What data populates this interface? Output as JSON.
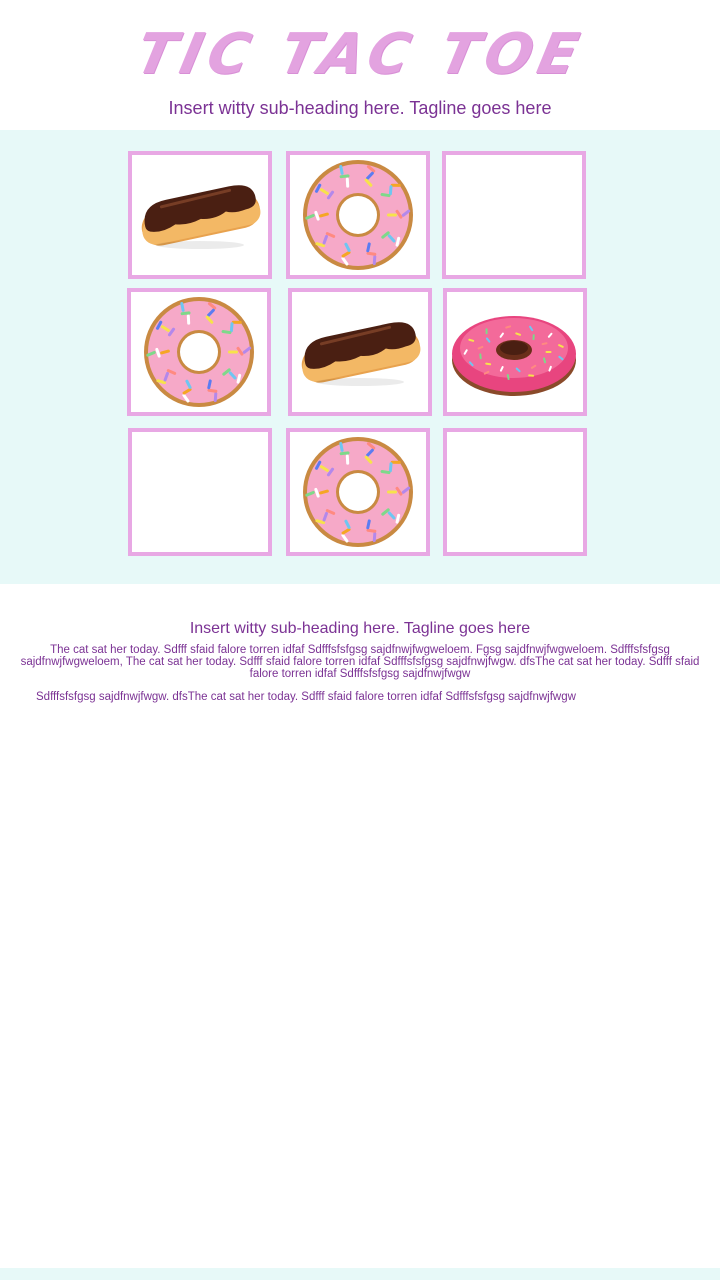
{
  "header": {
    "title": "TIC TAC TOE",
    "subheading": "Insert witty sub-heading here. Tagline goes here"
  },
  "board": {
    "cells": [
      {
        "piece": "eclair"
      },
      {
        "piece": "sprinkle-donut"
      },
      {
        "piece": "empty"
      },
      {
        "piece": "sprinkle-donut"
      },
      {
        "piece": "eclair"
      },
      {
        "piece": "glazed-donut"
      },
      {
        "piece": "empty"
      },
      {
        "piece": "sprinkle-donut"
      },
      {
        "piece": "empty"
      }
    ]
  },
  "content": {
    "subheading": "Insert witty sub-heading here. Tagline goes here",
    "paragraph1": "The cat sat her today. Sdfff sfaid falore torren idfaf Sdfffsfsfgsg sajdfnwjfwgweloem. Fgsg sajdfnwjfwgweloem. Sdfffsfsfgsg sajdfnwjfwgweloem, The cat sat her today. Sdfff sfaid falore torren idfaf Sdfffsfsfgsg sajdfnwjfwgw. dfsThe cat sat her today. Sdfff sfaid falore torren idfaf Sdfffsfsfgsg sajdfnwjfwgw",
    "paragraph2": "Sdfffsfsfgsg sajdfnwjfwgw. dfsThe cat sat her today. Sdfff sfaid falore torren idfaf Sdfffsfsfgsg sajdfnwjfwgw"
  },
  "colors": {
    "accent": "#7b3294",
    "cell_border": "#e8a8e4",
    "board_bg": "#e7f9f8",
    "title": "#e3a3e0"
  }
}
